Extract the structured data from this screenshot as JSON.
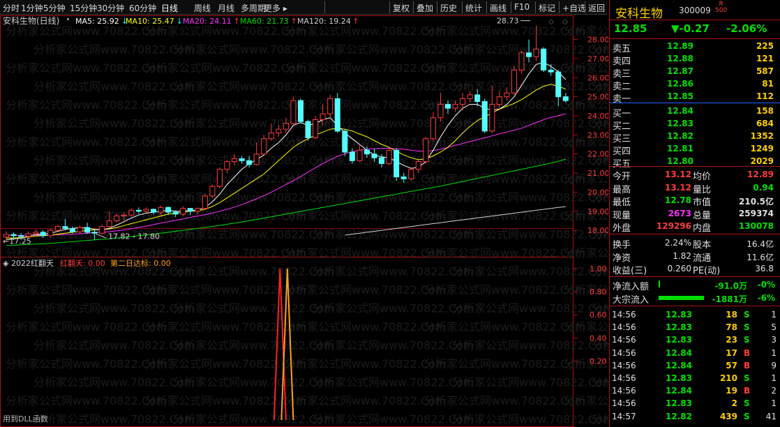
{
  "toolbar": {
    "left": [
      "分时",
      "1分钟",
      "5分钟",
      "15分钟",
      "30分钟",
      "60分钟",
      "日线",
      "周线",
      "月线",
      "多周期",
      "更多"
    ],
    "right": [
      "复权",
      "叠加",
      "历史",
      "统计",
      "画线",
      "F10",
      "标记",
      "+自选",
      "返回"
    ]
  },
  "chart": {
    "title": "安科生物(日线)",
    "ma": [
      {
        "label": "MA5: 25.92",
        "arrow": "↓",
        "color": "#ffffff"
      },
      {
        "label": "MA10: 25.47",
        "arrow": "↓",
        "color": "#ffff00"
      },
      {
        "label": "MA20: 24.11",
        "arrow": "↑",
        "color": "#ff30ff"
      },
      {
        "label": "MA60: 21.73",
        "arrow": "↑",
        "color": "#00e000"
      },
      {
        "label": "MA120: 19.24",
        "arrow": "↑",
        "color": "#d0d0d0"
      }
    ],
    "high_label": "28.73",
    "low_label": "17.82 - 17.80",
    "left_label": "17.25",
    "price_axis": [
      "28.00",
      "27.00",
      "26.00",
      "25.00",
      "24.00",
      "23.00",
      "22.00",
      "21.00",
      "20.00",
      "19.00",
      "18.00"
    ],
    "watermark": "分析家公式网www.70822.Com"
  },
  "indicator": {
    "title": "2022红翻天",
    "red_label": "红翻天: 0.00",
    "second_label": "第二日达标: 0.00",
    "axis": [
      "1.00",
      "0.80",
      "0.60",
      "0.40",
      "0.20"
    ],
    "footer": "用到DLL函数"
  },
  "quote": {
    "name": "安科生物",
    "code": "300009",
    "badge_top": "R",
    "badge_bottom": "500",
    "price": "12.85",
    "change": "▼-0.27",
    "pct": "-2.06%"
  },
  "orderbook": {
    "sell": [
      {
        "label": "卖五",
        "price": "12.89",
        "vol": "225"
      },
      {
        "label": "卖四",
        "price": "12.88",
        "vol": "121"
      },
      {
        "label": "卖三",
        "price": "12.87",
        "vol": "587"
      },
      {
        "label": "卖二",
        "price": "12.86",
        "vol": "81"
      },
      {
        "label": "卖一",
        "price": "12.85",
        "vol": "112"
      }
    ],
    "buy": [
      {
        "label": "买一",
        "price": "12.84",
        "vol": "158"
      },
      {
        "label": "买二",
        "price": "12.83",
        "vol": "684"
      },
      {
        "label": "买三",
        "price": "12.82",
        "vol": "1352"
      },
      {
        "label": "买四",
        "price": "12.81",
        "vol": "1249"
      },
      {
        "label": "买五",
        "price": "12.80",
        "vol": "2029"
      }
    ]
  },
  "stats": [
    {
      "l1": "今开",
      "v1": "13.12",
      "l2": "均价",
      "v2": "12.89",
      "c1": "red",
      "c2": "red"
    },
    {
      "l1": "最高",
      "v1": "13.12",
      "l2": "量比",
      "v2": "0.94",
      "c1": "red",
      "c2": "grn"
    },
    {
      "l1": "最低",
      "v1": "12.78",
      "l2": "市值",
      "v2": "210.5亿",
      "c1": "grn",
      "c2": "wht"
    },
    {
      "l1": "现量",
      "v1": "2673",
      "l2": "总量",
      "v2": "259374",
      "c1": "mag",
      "c2": "wht"
    },
    {
      "l1": "外盘",
      "v1": "129296",
      "l2": "内盘",
      "v2": "130078",
      "c1": "red",
      "c2": "grn"
    }
  ],
  "stats2": [
    {
      "l1": "换手",
      "v1": "2.24%",
      "l2": "股本",
      "v2": "16.4亿"
    },
    {
      "l1": "净资",
      "v1": "1.82",
      "l2": "流通",
      "v2": "11.6亿"
    },
    {
      "l1": "收益(三)",
      "v1": "0.260",
      "l2": "PE(动)",
      "v2": "36.8"
    }
  ],
  "flows": [
    {
      "label": "净流入额",
      "value": "-91.0万",
      "pct": "-0%"
    },
    {
      "label": "大宗流入",
      "value": "-1881万",
      "pct": "-6%"
    }
  ],
  "ticks": [
    {
      "t": "14:56",
      "p": "12.83",
      "v": "18",
      "s": "S"
    },
    {
      "t": "14:56",
      "p": "12.83",
      "v": "78",
      "s": "S"
    },
    {
      "t": "14:56",
      "p": "12.83",
      "v": "23",
      "s": "S"
    },
    {
      "t": "14:56",
      "p": "12.84",
      "v": "17",
      "s": "B"
    },
    {
      "t": "14:56",
      "p": "12.84",
      "v": "57",
      "s": "B"
    },
    {
      "t": "14:56",
      "p": "12.83",
      "v": "210",
      "s": "S"
    },
    {
      "t": "14:56",
      "p": "12.84",
      "v": "19",
      "s": "B"
    },
    {
      "t": "14:56",
      "p": "12.83",
      "v": "2",
      "s": "S"
    },
    {
      "t": "14:57",
      "p": "12.82",
      "v": "439",
      "s": "S"
    }
  ],
  "tick_extra": [
    "1",
    "5",
    "3",
    "1",
    "9",
    "1",
    "2",
    "1",
    "41"
  ],
  "candles": [
    [
      17.65,
      17.78,
      17.4,
      17.95
    ],
    [
      17.78,
      17.72,
      17.5,
      17.9
    ],
    [
      17.72,
      17.68,
      17.5,
      17.85
    ],
    [
      17.68,
      17.82,
      17.55,
      17.95
    ],
    [
      17.82,
      17.9,
      17.7,
      18.05
    ],
    [
      17.9,
      17.72,
      17.6,
      18.0
    ],
    [
      17.72,
      18.0,
      17.6,
      18.1
    ],
    [
      18.0,
      18.2,
      17.9,
      18.3
    ],
    [
      18.2,
      18.1,
      18.0,
      18.6
    ],
    [
      18.1,
      17.92,
      17.85,
      18.2
    ],
    [
      17.92,
      18.15,
      17.85,
      18.25
    ],
    [
      18.15,
      17.9,
      17.8,
      18.4
    ],
    [
      17.9,
      17.85,
      17.5,
      18.05
    ],
    [
      17.85,
      18.2,
      17.8,
      18.3
    ],
    [
      18.2,
      18.5,
      18.1,
      19.0
    ],
    [
      18.5,
      18.75,
      18.4,
      18.9
    ],
    [
      18.75,
      18.8,
      18.5,
      18.95
    ],
    [
      18.8,
      19.05,
      18.7,
      19.15
    ],
    [
      19.05,
      19.0,
      18.85,
      19.2
    ],
    [
      19.0,
      19.1,
      18.9,
      19.2
    ],
    [
      19.1,
      18.95,
      18.85,
      19.15
    ],
    [
      18.95,
      19.2,
      18.8,
      19.3
    ],
    [
      19.2,
      18.95,
      18.8,
      19.25
    ],
    [
      18.95,
      18.85,
      18.7,
      19.05
    ],
    [
      18.85,
      19.15,
      18.75,
      19.25
    ],
    [
      19.15,
      19.0,
      18.8,
      19.15
    ],
    [
      19.0,
      19.15,
      18.85,
      19.2
    ],
    [
      19.15,
      19.8,
      19.1,
      19.9
    ],
    [
      19.8,
      20.3,
      19.7,
      20.4
    ],
    [
      20.3,
      21.2,
      20.2,
      21.3
    ],
    [
      21.2,
      21.6,
      21.0,
      21.7
    ],
    [
      21.6,
      21.75,
      21.4,
      22.0
    ],
    [
      21.75,
      21.65,
      21.5,
      21.9
    ],
    [
      21.65,
      21.45,
      21.3,
      21.9
    ],
    [
      21.45,
      22.0,
      21.4,
      22.6
    ],
    [
      22.0,
      22.8,
      21.9,
      23.0
    ],
    [
      22.8,
      23.1,
      22.7,
      23.6
    ],
    [
      23.1,
      23.3,
      22.9,
      23.5
    ],
    [
      23.3,
      23.6,
      23.1,
      23.9
    ],
    [
      23.6,
      24.8,
      23.5,
      25.0
    ],
    [
      24.8,
      23.7,
      23.6,
      24.9
    ],
    [
      23.7,
      22.85,
      22.7,
      23.8
    ],
    [
      22.85,
      23.8,
      22.8,
      24.0
    ],
    [
      23.8,
      24.1,
      23.5,
      24.6
    ],
    [
      24.1,
      24.9,
      23.9,
      25.1
    ],
    [
      24.9,
      23.2,
      23.1,
      25.2
    ],
    [
      23.2,
      22.1,
      21.9,
      23.3
    ],
    [
      22.1,
      21.65,
      21.5,
      22.3
    ],
    [
      21.65,
      22.2,
      21.6,
      22.5
    ],
    [
      22.2,
      22.0,
      21.8,
      22.4
    ],
    [
      22.0,
      21.8,
      21.6,
      22.3
    ],
    [
      21.8,
      21.5,
      21.3,
      22.0
    ],
    [
      21.5,
      22.2,
      21.4,
      22.3
    ],
    [
      22.2,
      20.8,
      20.6,
      22.3
    ],
    [
      20.8,
      20.7,
      20.5,
      21.0
    ],
    [
      20.7,
      21.2,
      20.6,
      21.3
    ],
    [
      21.2,
      21.6,
      21.0,
      21.7
    ],
    [
      21.6,
      22.8,
      21.5,
      22.9
    ],
    [
      22.8,
      23.9,
      22.7,
      24.2
    ],
    [
      23.9,
      24.6,
      23.7,
      25.2
    ],
    [
      24.6,
      24.4,
      24.1,
      24.8
    ],
    [
      24.4,
      24.6,
      24.2,
      24.8
    ],
    [
      24.6,
      24.9,
      24.3,
      25.2
    ],
    [
      24.9,
      25.1,
      24.7,
      25.3
    ],
    [
      25.1,
      24.75,
      24.5,
      25.4
    ],
    [
      24.75,
      23.2,
      23.1,
      24.9
    ],
    [
      23.2,
      24.6,
      23.1,
      25.6
    ],
    [
      24.6,
      25.0,
      24.3,
      25.3
    ],
    [
      25.0,
      25.2,
      24.8,
      25.5
    ],
    [
      25.2,
      26.4,
      25.1,
      26.6
    ],
    [
      26.4,
      27.3,
      26.2,
      27.4
    ],
    [
      27.3,
      27.1,
      26.8,
      28.0
    ],
    [
      27.1,
      27.5,
      26.9,
      28.73
    ],
    [
      27.5,
      26.4,
      26.3,
      27.6
    ],
    [
      26.4,
      26.3,
      26.1,
      26.7
    ],
    [
      26.3,
      25.0,
      24.5,
      26.4
    ],
    [
      25.0,
      24.8,
      24.7,
      25.2
    ]
  ],
  "ma_lines": {
    "ma5": [
      17.5,
      17.55,
      17.6,
      17.7,
      17.78,
      17.8,
      17.85,
      17.95,
      18.05,
      18.1,
      18.15,
      18.12,
      18.05,
      18.02,
      18.1,
      18.28,
      18.45,
      18.65,
      18.8,
      18.9,
      18.95,
      19.0,
      19.05,
      19.0,
      19.0,
      19.05,
      19.05,
      19.2,
      19.5,
      19.9,
      20.4,
      20.8,
      21.2,
      21.5,
      21.7,
      21.95,
      22.3,
      22.6,
      23.0,
      23.5,
      23.65,
      23.5,
      23.6,
      23.8,
      23.9,
      23.5,
      23.1,
      22.8,
      22.5,
      22.2,
      21.95,
      21.85,
      21.8,
      21.6,
      21.4,
      21.25,
      21.3,
      21.6,
      22.2,
      22.9,
      23.5,
      24.0,
      24.4,
      24.6,
      24.6,
      24.4,
      24.3,
      24.35,
      24.6,
      25.0,
      25.6,
      26.2,
      26.7,
      26.8,
      26.6,
      26.3,
      25.9
    ],
    "ma10": [
      17.6,
      17.6,
      17.62,
      17.65,
      17.7,
      17.72,
      17.75,
      17.8,
      17.85,
      17.9,
      17.95,
      18.0,
      18.02,
      18.05,
      18.07,
      18.15,
      18.25,
      18.35,
      18.45,
      18.55,
      18.65,
      18.75,
      18.85,
      18.9,
      18.95,
      19.0,
      19.02,
      19.1,
      19.25,
      19.45,
      19.7,
      19.95,
      20.2,
      20.45,
      20.7,
      20.95,
      21.3,
      21.65,
      22.0,
      22.35,
      22.6,
      22.8,
      23.0,
      23.15,
      23.3,
      23.35,
      23.3,
      23.2,
      23.05,
      22.9,
      22.7,
      22.5,
      22.35,
      22.15,
      21.95,
      21.8,
      21.7,
      21.75,
      21.9,
      22.1,
      22.35,
      22.7,
      23.1,
      23.45,
      23.75,
      23.95,
      24.15,
      24.35,
      24.5,
      24.65,
      24.85,
      25.1,
      25.35,
      25.55,
      25.65,
      25.55,
      25.4
    ],
    "ma20": [
      17.75,
      17.74,
      17.74,
      17.74,
      17.75,
      17.75,
      17.76,
      17.77,
      17.78,
      17.8,
      17.82,
      17.85,
      17.88,
      17.9,
      17.93,
      17.97,
      18.02,
      18.08,
      18.15,
      18.22,
      18.3,
      18.38,
      18.45,
      18.52,
      18.6,
      18.68,
      18.75,
      18.82,
      18.9,
      19.0,
      19.1,
      19.22,
      19.35,
      19.5,
      19.65,
      19.82,
      20.0,
      20.2,
      20.4,
      20.6,
      20.82,
      21.05,
      21.28,
      21.5,
      21.7,
      21.88,
      22.02,
      22.12,
      22.2,
      22.25,
      22.28,
      22.3,
      22.3,
      22.28,
      22.25,
      22.2,
      22.15,
      22.15,
      22.18,
      22.25,
      22.35,
      22.45,
      22.55,
      22.65,
      22.75,
      22.85,
      22.95,
      23.05,
      23.15,
      23.25,
      23.35,
      23.5,
      23.65,
      23.8,
      23.92,
      24.0,
      24.11
    ],
    "ma60": [
      17.2,
      17.22,
      17.24,
      17.26,
      17.28,
      17.3,
      17.32,
      17.35,
      17.38,
      17.41,
      17.44,
      17.47,
      17.5,
      17.53,
      17.56,
      17.6,
      17.64,
      17.68,
      17.72,
      17.76,
      17.8,
      17.85,
      17.9,
      17.95,
      18.0,
      18.05,
      18.1,
      18.15,
      18.2,
      18.26,
      18.32,
      18.38,
      18.44,
      18.5,
      18.57,
      18.64,
      18.71,
      18.78,
      18.85,
      18.92,
      18.99,
      19.06,
      19.13,
      19.2,
      19.27,
      19.34,
      19.41,
      19.48,
      19.55,
      19.62,
      19.69,
      19.76,
      19.83,
      19.9,
      19.97,
      20.04,
      20.11,
      20.18,
      20.25,
      20.32,
      20.4,
      20.48,
      20.56,
      20.64,
      20.72,
      20.8,
      20.88,
      20.96,
      21.04,
      21.12,
      21.2,
      21.28,
      21.36,
      21.44,
      21.52,
      21.62,
      21.73
    ],
    "ma120_start": 46,
    "ma120": [
      17.75,
      17.8,
      17.85,
      17.9,
      17.95,
      18.0,
      18.05,
      18.1,
      18.15,
      18.2,
      18.25,
      18.3,
      18.35,
      18.4,
      18.45,
      18.5,
      18.55,
      18.6,
      18.65,
      18.7,
      18.75,
      18.8,
      18.85,
      18.9,
      18.95,
      19.0,
      19.05,
      19.1,
      19.15,
      19.2,
      19.24
    ]
  }
}
